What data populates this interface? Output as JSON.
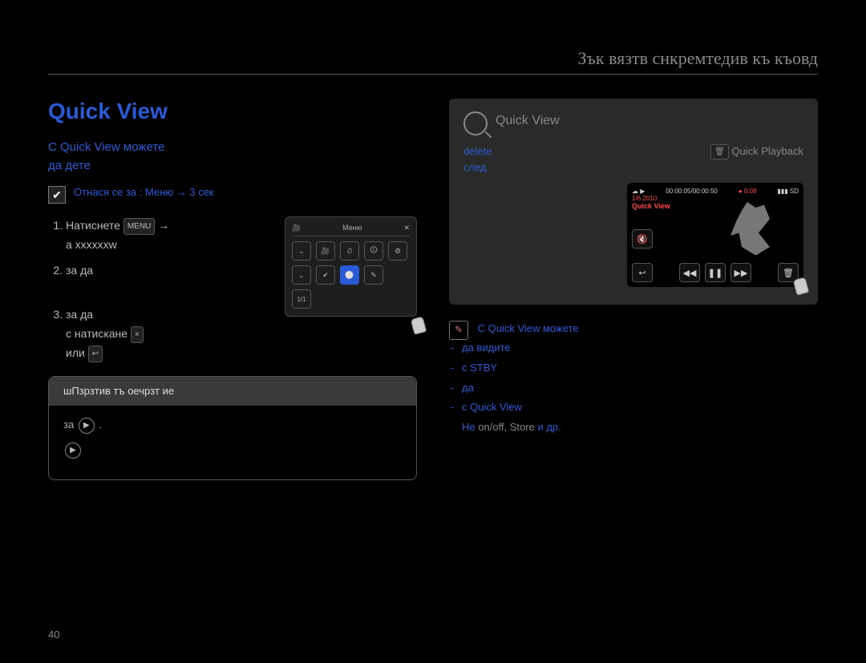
{
  "header": {
    "chapter_title": "Зък вязтв снкремтедив къ къовд"
  },
  "left": {
    "h1": "Quick View",
    "intro_line1": "С Quick View можете",
    "intro_line2": "да дете",
    "check_note": "Отнася се за : Меню → 3 сек",
    "step1_a": "Натиснете",
    "step1_menu_chip": "MENU",
    "step1_b": "a xxxxxxw",
    "step2": "за да",
    "step3_a": "за да",
    "step3_b": "с натискане",
    "step3_close_chip": "×",
    "step3_c": "или",
    "step3_back_chip": "↩",
    "screenshot_a": {
      "title": "Меню",
      "close": "✕",
      "col_icons": [
        "⌄",
        "⌄",
        "1/1"
      ],
      "grid": [
        "🎥",
        "⏱",
        "🛈",
        "⚙",
        "✔",
        "⚪",
        "✎"
      ]
    },
    "tip": {
      "bar_title": "шПзрзтив тъ оечрзт ие",
      "line1_left": "за",
      "play1": "▶",
      "line1_right": ".",
      "line2": "",
      "play2": "▶"
    }
  },
  "right": {
    "panel": {
      "head": "Quick View",
      "left_label_delete": "delete",
      "left_text_tail": "след",
      "right_chip_trash": "🗑",
      "right_label": "Quick Playback",
      "video": {
        "status_icons": "☁ ▶",
        "time": "00:00:05/00:00:50",
        "rec": "● 0:08",
        "date": "1/6.2010",
        "qvlabel": "Quick View",
        "batt": "▮▮▮",
        "sd": "SD",
        "mute": "🔇",
        "back": "↩",
        "rew": "◀◀",
        "pause": "❚❚",
        "ff": "▶▶",
        "trash": "🗑"
      }
    },
    "bullets_head": "С Quick View можете",
    "b1": "да видите",
    "b2": "с STBY",
    "b3": "да",
    "b4": "с Quick View",
    "tail_a": "Не",
    "tail_b": "on/off, Store",
    "tail_c": "и др."
  },
  "page_number": "40"
}
